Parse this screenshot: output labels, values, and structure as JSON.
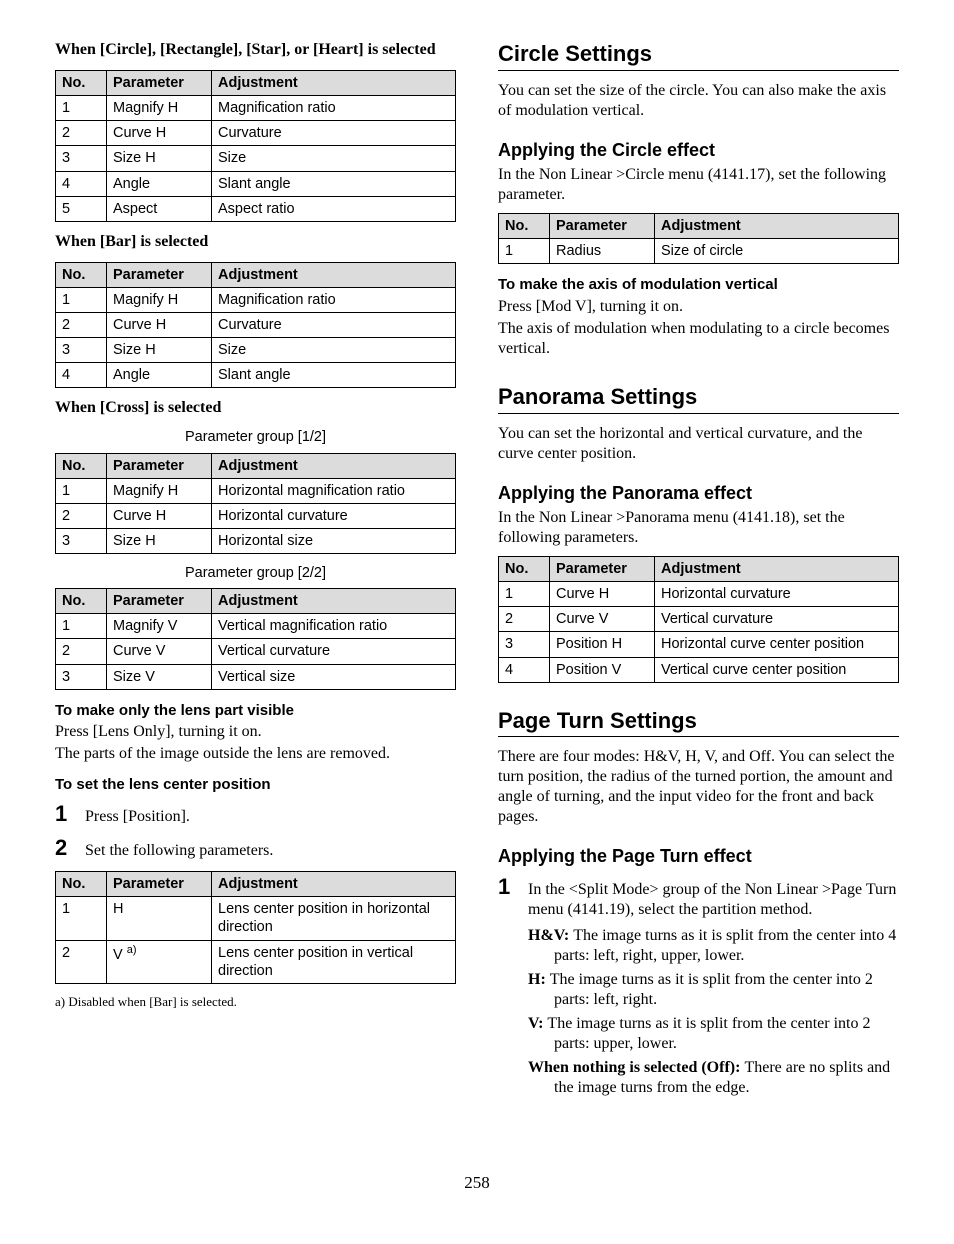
{
  "page_number": "258",
  "left": {
    "h_circle_etc": "When [Circle], [Rectangle], [Star], or [Heart] is selected",
    "tbl_hdr_no": "No.",
    "tbl_hdr_param": "Parameter",
    "tbl_hdr_adj": "Adjustment",
    "t1": {
      "r1n": "1",
      "r1p": "Magnify H",
      "r1a": "Magnification ratio",
      "r2n": "2",
      "r2p": "Curve H",
      "r2a": "Curvature",
      "r3n": "3",
      "r3p": "Size H",
      "r3a": "Size",
      "r4n": "4",
      "r4p": "Angle",
      "r4a": "Slant angle",
      "r5n": "5",
      "r5p": "Aspect",
      "r5a": "Aspect ratio"
    },
    "h_bar": "When [Bar] is selected",
    "t2": {
      "r1n": "1",
      "r1p": "Magnify H",
      "r1a": "Magnification ratio",
      "r2n": "2",
      "r2p": "Curve H",
      "r2a": "Curvature",
      "r3n": "3",
      "r3p": "Size H",
      "r3a": "Size",
      "r4n": "4",
      "r4p": "Angle",
      "r4a": "Slant angle"
    },
    "h_cross": "When [Cross] is selected",
    "grp12": "Parameter group [1/2]",
    "t3": {
      "r1n": "1",
      "r1p": "Magnify H",
      "r1a": "Horizontal magnification ratio",
      "r2n": "2",
      "r2p": "Curve H",
      "r2a": "Horizontal curvature",
      "r3n": "3",
      "r3p": "Size H",
      "r3a": "Horizontal size"
    },
    "grp22": "Parameter group [2/2]",
    "t4": {
      "r1n": "1",
      "r1p": "Magnify V",
      "r1a": "Vertical magnification ratio",
      "r2n": "2",
      "r2p": "Curve V",
      "r2a": "Vertical curvature",
      "r3n": "3",
      "r3p": "Size V",
      "r3a": "Vertical size"
    },
    "h_lensonly": "To make only the lens part visible",
    "lensonly_p1": "Press [Lens Only], turning it on.",
    "lensonly_p2": "The parts of the image outside the lens are removed.",
    "h_lenscenter": "To set the lens center position",
    "step1": "Press [Position].",
    "step2": "Set the following parameters.",
    "t5": {
      "r1n": "1",
      "r1p": "H",
      "r1a": "Lens center position in horizontal direction",
      "r2n": "2",
      "r2p": "V ",
      "r2p_sup": "a)",
      "r2a": "Lens center position in vertical direction"
    },
    "footnote": "a) Disabled when [Bar] is selected."
  },
  "right": {
    "h_circle": "Circle Settings",
    "circle_intro": "You can set the size of the circle. You can also make the axis of modulation vertical.",
    "h_apply_circle": "Applying the Circle effect",
    "circle_body": "In the Non Linear >Circle menu (4141.17), set the following parameter.",
    "t6": {
      "r1n": "1",
      "r1p": "Radius",
      "r1a": "Size of circle"
    },
    "h_axis": "To make the axis of modulation vertical",
    "axis_p1": "Press [Mod V], turning it on.",
    "axis_p2": "The axis of modulation when modulating to a circle becomes vertical.",
    "h_panorama": "Panorama Settings",
    "panorama_intro": "You can set the horizontal and vertical curvature, and the curve center position.",
    "h_apply_panorama": "Applying the Panorama effect",
    "panorama_body": "In the Non Linear >Panorama menu (4141.18), set the following parameters.",
    "t7": {
      "r1n": "1",
      "r1p": "Curve H",
      "r1a": "Horizontal curvature",
      "r2n": "2",
      "r2p": "Curve V",
      "r2a": "Vertical curvature",
      "r3n": "3",
      "r3p": "Position H",
      "r3a": "Horizontal curve center position",
      "r4n": "4",
      "r4p": "Position V",
      "r4a": "Vertical curve center position"
    },
    "h_pageturn": "Page Turn Settings",
    "pageturn_intro": "There are four modes: H&V, H, V, and Off. You can select the turn position, the radius of the turned portion, the amount and angle of turning, and the input video for the front and back pages.",
    "h_apply_pageturn": "Applying the Page Turn effect",
    "pt_step1": "In the <Split Mode> group of the Non Linear >Page Turn menu (4141.19), select the partition method.",
    "defs": {
      "d1t": "H&V: ",
      "d1b": "The image turns as it is split from the center into 4 parts: left, right, upper, lower.",
      "d2t": "H: ",
      "d2b": "The image turns as it is split from the center into 2 parts: left, right.",
      "d3t": "V: ",
      "d3b": "The image turns as it is split from the center into 2 parts: upper, lower.",
      "d4t": "When nothing is selected (Off): ",
      "d4b": "There are no splits and the image turns from the edge."
    }
  }
}
